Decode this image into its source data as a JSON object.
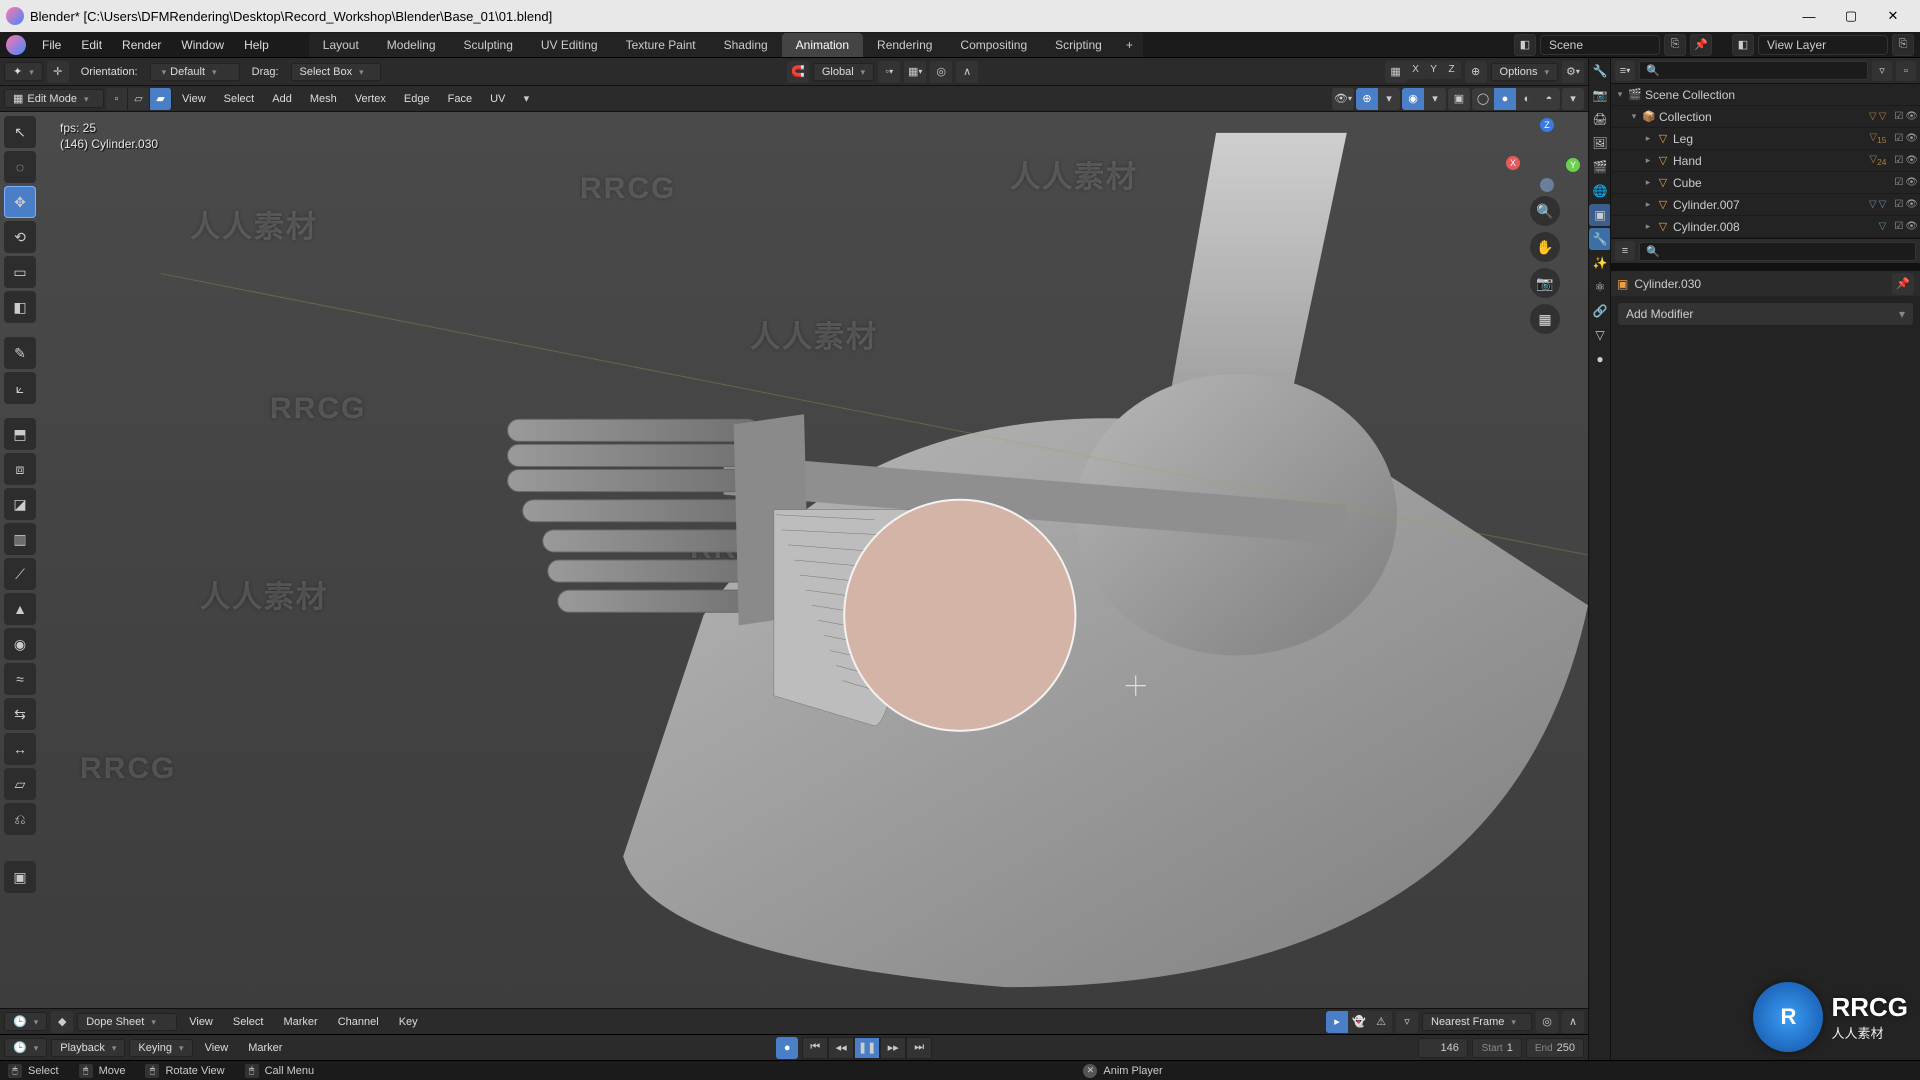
{
  "window": {
    "app": "Blender",
    "title": "Blender* [C:\\Users\\DFMRendering\\Desktop\\Record_Workshop\\Blender\\Base_01\\01.blend]"
  },
  "menus": [
    "File",
    "Edit",
    "Render",
    "Window",
    "Help"
  ],
  "workspaces": [
    "Layout",
    "Modeling",
    "Sculpting",
    "UV Editing",
    "Texture Paint",
    "Shading",
    "Animation",
    "Rendering",
    "Compositing",
    "Scripting"
  ],
  "workspace_active": "Animation",
  "scene": {
    "label": "Scene",
    "view_layer": "View Layer"
  },
  "viewport": {
    "mode": "Edit Mode",
    "orientation_label": "Orientation:",
    "orientation_value": "Default",
    "drag_label": "Drag:",
    "drag_value": "Select Box",
    "transform_space": "Global",
    "header_menus": [
      "View",
      "Select",
      "Add",
      "Mesh",
      "Vertex",
      "Edge",
      "Face",
      "UV"
    ],
    "options": "Options",
    "axes": [
      "X",
      "Y",
      "Z"
    ],
    "hud_fps": "fps: 25",
    "hud_obj": "(146) Cylinder.030"
  },
  "dope": {
    "editor": "Dope Sheet",
    "row1_menus": [
      "View",
      "Select",
      "Marker",
      "Channel",
      "Key"
    ],
    "row2_menus": [
      "Playback",
      "Keying",
      "View",
      "Marker"
    ],
    "nearest": "Nearest Frame",
    "frame": "146",
    "start_label": "Start",
    "start": "1",
    "end_label": "End",
    "end": "250"
  },
  "outliner": {
    "root": "Scene Collection",
    "items": [
      {
        "indent": 1,
        "name": "Collection",
        "icon": "📦",
        "badges": [
          "▽",
          "▽"
        ],
        "eye": false
      },
      {
        "indent": 2,
        "name": "Leg",
        "icon": "▽",
        "badges": [
          "▽₁₅"
        ],
        "eye": true
      },
      {
        "indent": 2,
        "name": "Hand",
        "icon": "▽",
        "badges": [
          "▽₂₄"
        ],
        "eye": true
      },
      {
        "indent": 2,
        "name": "Cube",
        "icon": "▽",
        "badges": [],
        "eye": true
      },
      {
        "indent": 2,
        "name": "Cylinder.007",
        "icon": "▽",
        "badges": [
          "▽",
          "▽"
        ],
        "eye": true
      },
      {
        "indent": 2,
        "name": "Cylinder.008",
        "icon": "▽",
        "badges": [
          "▽"
        ],
        "eye": true
      }
    ]
  },
  "properties": {
    "object": "Cylinder.030",
    "add_modifier": "Add Modifier"
  },
  "status": {
    "select": "Select",
    "move": "Move",
    "rotate": "Rotate View",
    "call": "Call Menu",
    "anim": "Anim Player"
  },
  "watermark": {
    "cn": "人人素材",
    "en": "RRCG"
  }
}
